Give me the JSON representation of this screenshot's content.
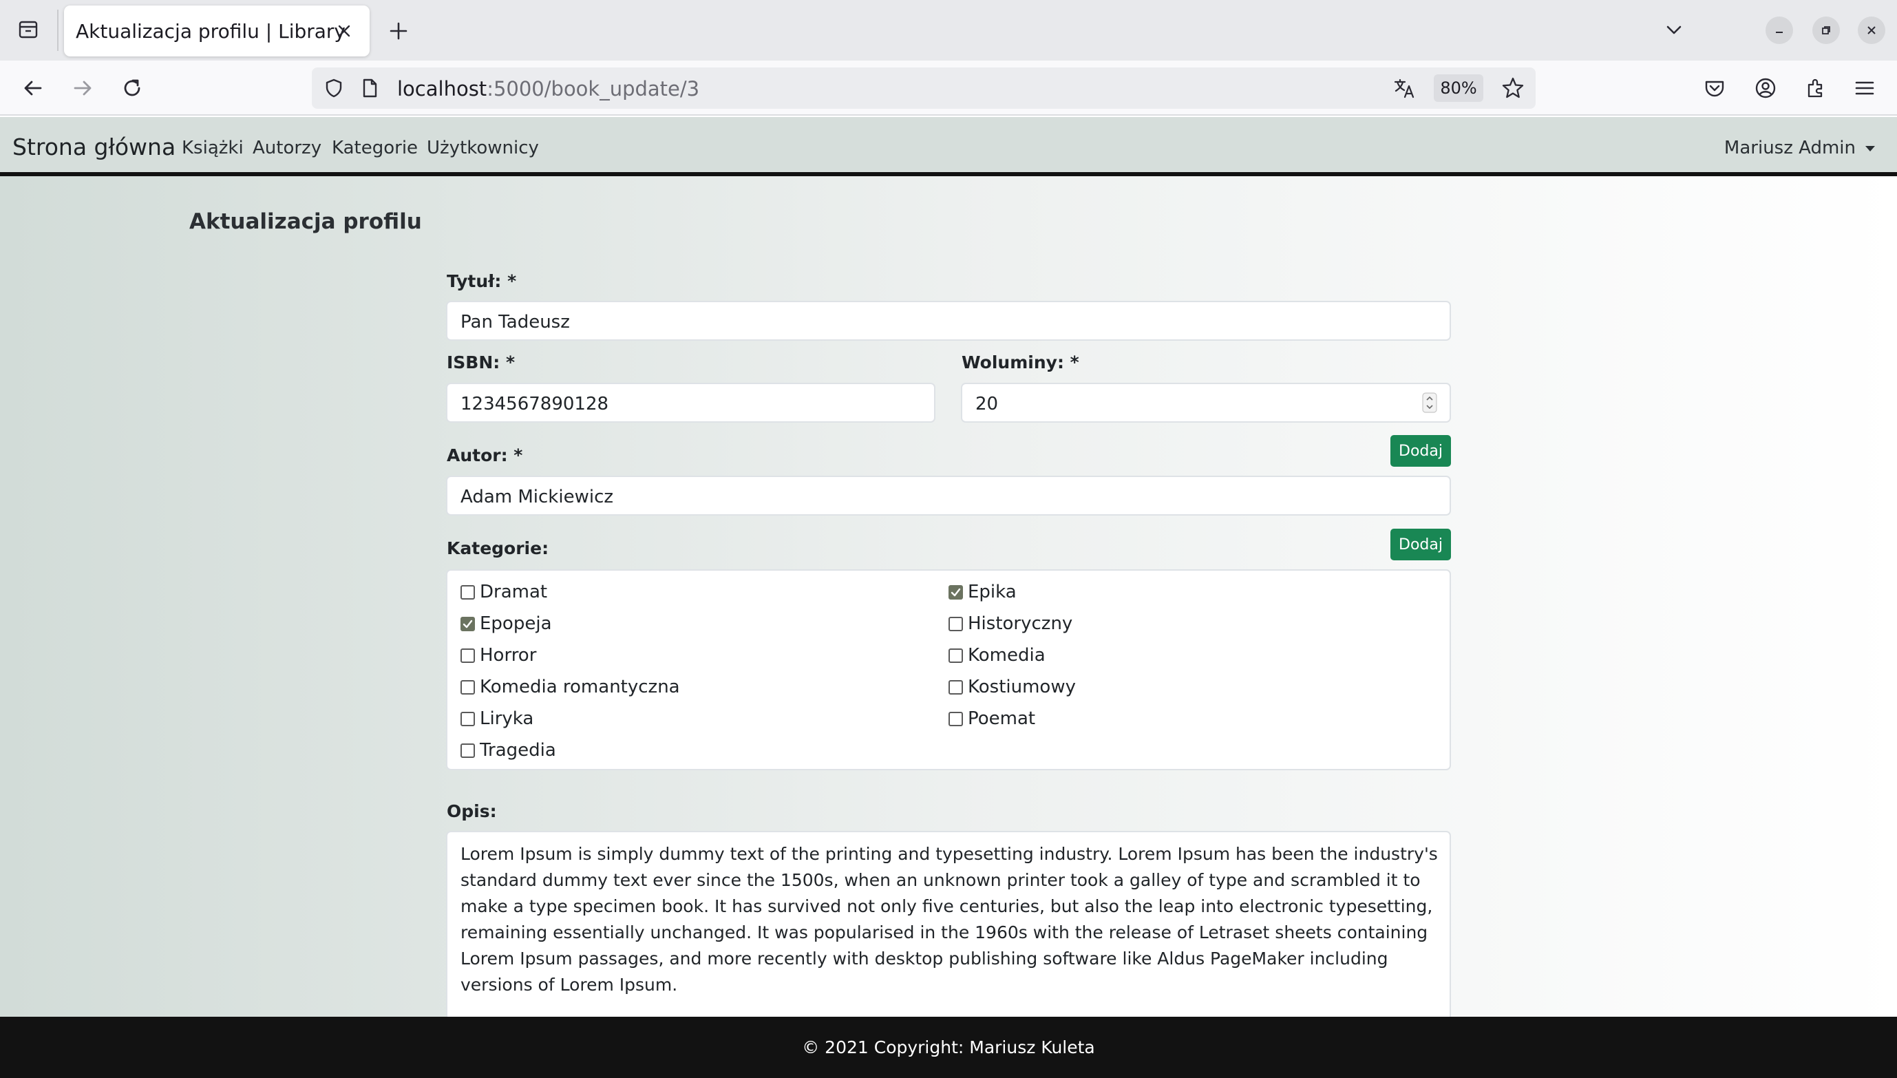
{
  "browser": {
    "tab_title": "Aktualizacja profilu | Library",
    "url_host": "localhost",
    "url_path": ":5000/book_update/3",
    "zoom": "80%"
  },
  "site": {
    "brand": "Strona główna",
    "nav": [
      "Książki",
      "Autorzy",
      "Kategorie",
      "Użytkownicy"
    ],
    "user": "Mariusz Admin"
  },
  "form": {
    "heading": "Aktualizacja profilu",
    "title_label": "Tytuł: *",
    "title_value": "Pan Tadeusz",
    "isbn_label": "ISBN: *",
    "isbn_value": "1234567890128",
    "volumes_label": "Woluminy: *",
    "volumes_value": "20",
    "author_label": "Autor: *",
    "author_value": "Adam Mickiewicz",
    "add_label": "Dodaj",
    "categories_label": "Kategorie:",
    "categories": [
      {
        "name": "Dramat",
        "checked": false
      },
      {
        "name": "Epika",
        "checked": true
      },
      {
        "name": "Epopeja",
        "checked": true
      },
      {
        "name": "Historyczny",
        "checked": false
      },
      {
        "name": "Horror",
        "checked": false
      },
      {
        "name": "Komedia",
        "checked": false
      },
      {
        "name": "Komedia romantyczna",
        "checked": false
      },
      {
        "name": "Kostiumowy",
        "checked": false
      },
      {
        "name": "Liryka",
        "checked": false
      },
      {
        "name": "Poemat",
        "checked": false
      },
      {
        "name": "Tragedia",
        "checked": false
      }
    ],
    "description_label": "Opis:",
    "description_value": "Lorem Ipsum is simply dummy text of the printing and typesetting industry. Lorem Ipsum has been the industry's standard dummy text ever since the 1500s, when an unknown printer took a galley of type and scrambled it to make a type specimen book. It has survived not only five centuries, but also the leap into electronic typesetting, remaining essentially unchanged. It was popularised in the 1960s with the release of Letraset sheets containing Lorem Ipsum passages, and more recently with desktop publishing software like Aldus PageMaker including versions of Lorem Ipsum."
  },
  "footer": "© 2021 Copyright: Mariusz Kuleta",
  "colors": {
    "accent_button": "#198754",
    "footer_bg": "#121212",
    "navbar_bg": "#d6dedb"
  }
}
